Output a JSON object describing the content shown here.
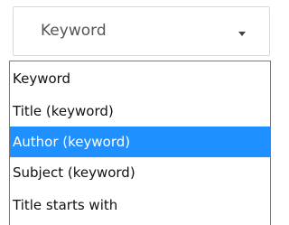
{
  "select": {
    "value": "Keyword",
    "caret_icon": "chevron-down-icon"
  },
  "dropdown": {
    "options": [
      {
        "label": "Keyword"
      },
      {
        "label": "Title (keyword)"
      },
      {
        "label": "Author (keyword)",
        "highlighted": true
      },
      {
        "label": "Subject (keyword)"
      },
      {
        "label": "Title starts with"
      }
    ],
    "highlight_color": "#1e90ff"
  }
}
